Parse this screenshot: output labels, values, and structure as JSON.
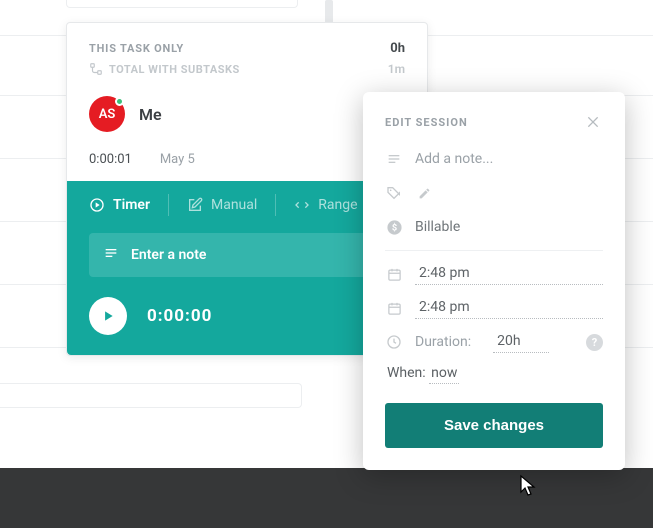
{
  "card": {
    "this_task_label": "THIS TASK ONLY",
    "this_task_value": "0h",
    "total_subtasks_label": "TOTAL WITH SUBTASKS",
    "total_subtasks_value": "1m",
    "user_initials": "AS",
    "user_name": "Me",
    "session_duration": "0:00:01",
    "session_date": "May 5"
  },
  "timer_panel": {
    "tabs": {
      "timer": "Timer",
      "manual": "Manual",
      "range": "Range"
    },
    "note_placeholder": "Enter a note",
    "running": "0:00:00"
  },
  "edit": {
    "title": "EDIT SESSION",
    "note_placeholder": "Add a note...",
    "billable_label": "Billable",
    "start_time": "2:48 pm",
    "end_time": "2:48 pm",
    "duration_label": "Duration:",
    "duration_value": "20h",
    "when_label": "When:",
    "when_value": "now",
    "save_label": "Save changes",
    "help_glyph": "?"
  },
  "colors": {
    "teal": "#14a89d",
    "teal_dark": "#127e76",
    "avatar": "#e51c23"
  }
}
